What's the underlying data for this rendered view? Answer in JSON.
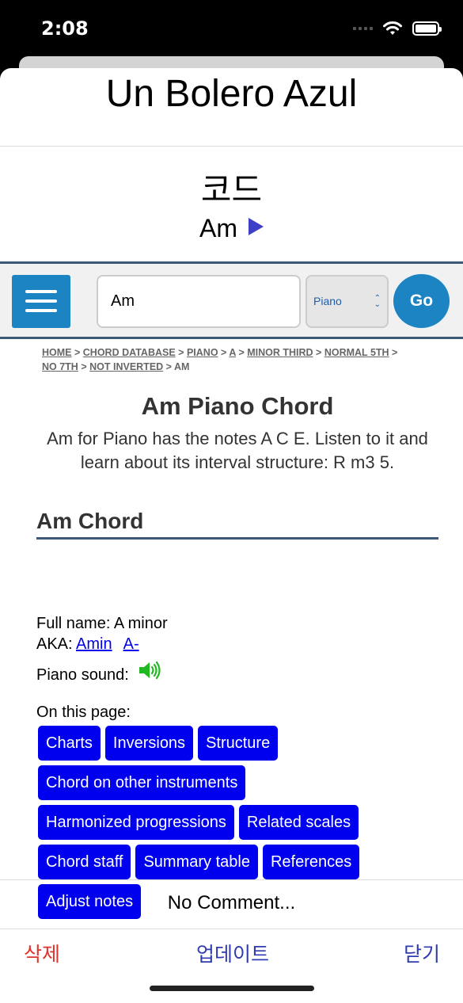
{
  "status": {
    "time": "2:08"
  },
  "song_title": "Un Bolero Azul",
  "chord_section": {
    "label": "코드",
    "chord": "Am"
  },
  "search": {
    "value": "Am",
    "instrument": "Piano",
    "go_label": "Go"
  },
  "breadcrumb": {
    "items": [
      "HOME",
      "CHORD DATABASE",
      "PIANO",
      "A",
      "MINOR THIRD",
      "NORMAL 5TH",
      "NO 7TH",
      "NOT INVERTED"
    ],
    "current": "AM",
    "separator": ">"
  },
  "page": {
    "heading": "Am Piano Chord",
    "intro": "Am for Piano has the notes A C E. Listen to it and learn about its interval structure: R m3 5.",
    "section_heading": "Am Chord",
    "full_name_label": "Full name: A minor",
    "aka_label": "AKA:",
    "aka_links": [
      "Amin",
      "A-"
    ],
    "sound_label": "Piano sound:",
    "on_this_page_label": "On this page:",
    "pill_rows": [
      [
        "Charts",
        "Inversions",
        "Structure"
      ],
      [
        "Chord on other instruments"
      ],
      [
        "Harmonized progressions",
        "Related scales"
      ],
      [
        "Chord staff",
        "Summary table",
        "References"
      ],
      [
        "Adjust notes"
      ]
    ]
  },
  "comment": "No Comment...",
  "footer": {
    "delete_label": "삭제",
    "update_label": "업데이트",
    "close_label": "닫기",
    "delete_color": "#e0322b",
    "action_color": "#2f3bb0"
  },
  "colors": {
    "accent_blue": "#1d84c4",
    "pill_blue": "#0000ee",
    "rule_navy": "#3c5a78"
  }
}
